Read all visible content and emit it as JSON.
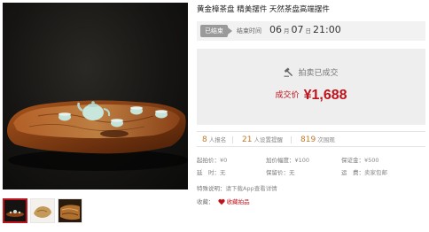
{
  "lot": {
    "title": "黄金樟茶盘 精美摆件 天然茶盘高端摆件"
  },
  "status": {
    "badge": "已结束",
    "end_label": "结束时间",
    "month": "06",
    "month_unit": "月",
    "day": "07",
    "day_unit": "日",
    "time": "21:00"
  },
  "deal": {
    "sold_text": "拍卖已成交",
    "price_label": "成交价",
    "price_value": "¥1,688"
  },
  "stats": {
    "bids_num": "8",
    "bids_label": "人报名",
    "reminders_num": "21",
    "reminders_label": "人设置提醒",
    "views_num": "819",
    "views_label": "次围观"
  },
  "details": {
    "start_price_label": "起拍价：",
    "start_price_value": "¥0",
    "increment_label": "加价幅度：",
    "increment_value": "¥100",
    "deposit_label": "保证金：",
    "deposit_value": "¥500",
    "extension_label": "延　时：",
    "extension_value": "无",
    "reserve_label": "保留价：",
    "reserve_value": "无",
    "delivery_label": "运　费：",
    "delivery_value": "卖家包邮",
    "notice_label": "特殊说明：",
    "notice_value": "请下载App查看详情",
    "favorite_label": "收藏：",
    "favorite_value": "收藏拍品"
  },
  "colors": {
    "accent_red": "#c0121b",
    "badge_gray": "#9a9a9a",
    "panel_gray": "#eeeeee",
    "stat_orange": "#c07a2a"
  },
  "icons": {
    "hammer": "auction-hammer-icon",
    "heart": "heart-icon"
  }
}
